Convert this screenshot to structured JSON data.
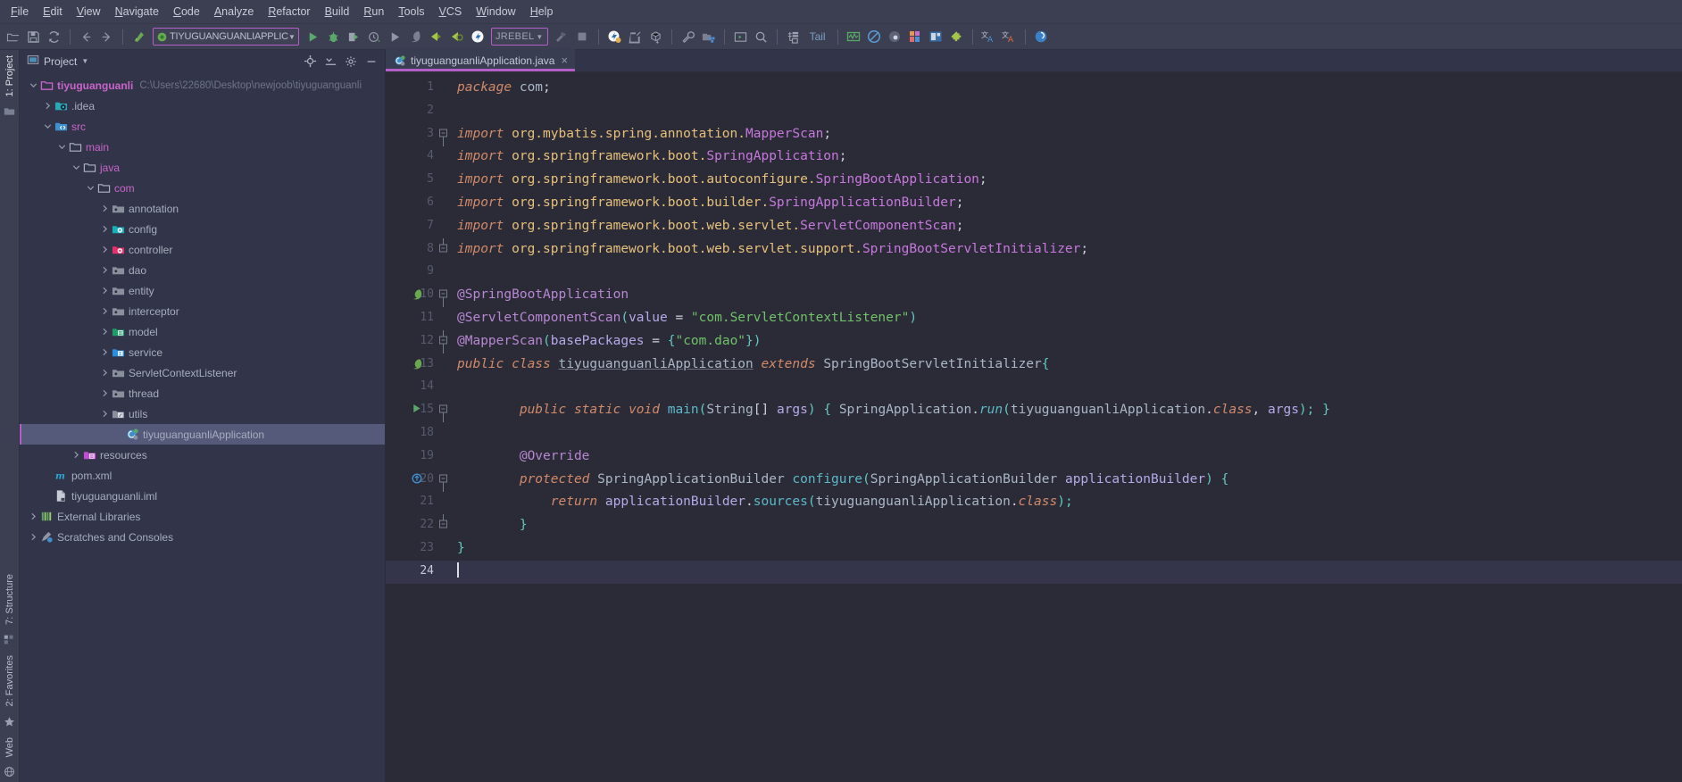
{
  "menu": {
    "items": [
      {
        "label": "File"
      },
      {
        "label": "Edit"
      },
      {
        "label": "View"
      },
      {
        "label": "Navigate"
      },
      {
        "label": "Code"
      },
      {
        "label": "Analyze"
      },
      {
        "label": "Refactor"
      },
      {
        "label": "Build"
      },
      {
        "label": "Run"
      },
      {
        "label": "Tools"
      },
      {
        "label": "VCS"
      },
      {
        "label": "Window"
      },
      {
        "label": "Help"
      }
    ]
  },
  "toolbar": {
    "run_config": "TIYUGUANGUANLIAPPLICATION",
    "run_config_arrow": "▼",
    "jrebel_label": "JREBEL",
    "jrebel_arrow": "▼",
    "tail_label": "Tail",
    "icons": [
      "open-folder-icon",
      "save-all-icon",
      "sync-refresh-icon",
      "back-arrow-icon",
      "forward-arrow-icon",
      "compile-icon",
      "run-icon",
      "debug-icon",
      "run-with-coverage-icon",
      "profile-icon",
      "rerun-icon",
      "stop-gray-icon",
      "jrebel-run-icon",
      "jrebel-debug-icon",
      "jrebel-logo-icon",
      "hammer-icon",
      "stop-square-icon",
      "jrebel-settings-icon",
      "update-app-icon",
      "build-artifact-icon",
      "wrench-settings-icon",
      "project-structure-icon",
      "terminal-icon",
      "search-everywhere-icon",
      "database-icon",
      "monitor-chart-icon",
      "no-entry-icon",
      "record-icon",
      "layout-colors-icon",
      "ui-designer-icon",
      "plugin-puzzle-icon",
      "translate-blue-icon",
      "translate-red-icon",
      "help-circle-icon"
    ]
  },
  "left_strip": {
    "tabs_top": [
      "1: Project"
    ],
    "tabs_bottom": [
      "7: Structure",
      "2: Favorites",
      "Web"
    ]
  },
  "project_panel": {
    "title": "Project",
    "title_arrow": "▼",
    "buttons": [
      "locate-target-icon",
      "collapse-all-icon",
      "settings-gear-icon",
      "hide-minus-icon"
    ],
    "tree": [
      {
        "depth": 0,
        "arrow": "down",
        "icon": "module-folder-icon",
        "label": "tiyuguanguanli",
        "style": "bold",
        "path": "C:\\Users\\22680\\Desktop\\newjoob\\tiyuguanguanli"
      },
      {
        "depth": 1,
        "arrow": "right",
        "icon": "idea-folder-icon",
        "label": ".idea",
        "style": "normal",
        "path": ""
      },
      {
        "depth": 1,
        "arrow": "down",
        "icon": "source-folder-icon",
        "label": "src",
        "style": "pink",
        "path": ""
      },
      {
        "depth": 2,
        "arrow": "down",
        "icon": "plain-folder-icon",
        "label": "main",
        "style": "pink",
        "path": ""
      },
      {
        "depth": 3,
        "arrow": "down",
        "icon": "plain-folder-icon",
        "label": "java",
        "style": "pink",
        "path": ""
      },
      {
        "depth": 4,
        "arrow": "down",
        "icon": "plain-folder-icon",
        "label": "com",
        "style": "pink",
        "path": ""
      },
      {
        "depth": 5,
        "arrow": "right",
        "icon": "package-folder-icon",
        "label": "annotation",
        "style": "normal",
        "path": ""
      },
      {
        "depth": 5,
        "arrow": "right",
        "icon": "config-folder-icon",
        "label": "config",
        "style": "normal",
        "path": ""
      },
      {
        "depth": 5,
        "arrow": "right",
        "icon": "controller-folder-icon",
        "label": "controller",
        "style": "normal",
        "path": ""
      },
      {
        "depth": 5,
        "arrow": "right",
        "icon": "package-folder-icon",
        "label": "dao",
        "style": "normal",
        "path": ""
      },
      {
        "depth": 5,
        "arrow": "right",
        "icon": "package-folder-icon",
        "label": "entity",
        "style": "normal",
        "path": ""
      },
      {
        "depth": 5,
        "arrow": "right",
        "icon": "package-folder-icon",
        "label": "interceptor",
        "style": "normal",
        "path": ""
      },
      {
        "depth": 5,
        "arrow": "right",
        "icon": "model-folder-icon",
        "label": "model",
        "style": "normal",
        "path": ""
      },
      {
        "depth": 5,
        "arrow": "right",
        "icon": "service-folder-icon",
        "label": "service",
        "style": "normal",
        "path": ""
      },
      {
        "depth": 5,
        "arrow": "right",
        "icon": "package-folder-icon",
        "label": "ServletContextListener",
        "style": "normal",
        "path": ""
      },
      {
        "depth": 5,
        "arrow": "right",
        "icon": "package-folder-icon",
        "label": "thread",
        "style": "normal",
        "path": ""
      },
      {
        "depth": 5,
        "arrow": "right",
        "icon": "utils-folder-icon",
        "label": "utils",
        "style": "normal",
        "path": ""
      },
      {
        "depth": 6,
        "arrow": "none",
        "icon": "spring-class-icon",
        "label": "tiyuguanguanliApplication",
        "style": "normal",
        "path": "",
        "selected": true
      },
      {
        "depth": 3,
        "arrow": "right",
        "icon": "resources-folder-icon",
        "label": "resources",
        "style": "normal",
        "path": ""
      },
      {
        "depth": 1,
        "arrow": "none",
        "icon": "maven-pom-icon",
        "label": "pom.xml",
        "style": "normal",
        "path": ""
      },
      {
        "depth": 1,
        "arrow": "none",
        "icon": "iml-file-icon",
        "label": "tiyuguanguanli.iml",
        "style": "normal",
        "path": ""
      },
      {
        "depth": 0,
        "arrow": "right",
        "icon": "external-libraries-icon",
        "label": "External Libraries",
        "style": "normal",
        "path": ""
      },
      {
        "depth": 0,
        "arrow": "right",
        "icon": "scratches-icon",
        "label": "Scratches and Consoles",
        "style": "normal",
        "path": ""
      }
    ]
  },
  "editor": {
    "tab": {
      "label": "tiyuguanguanliApplication.java",
      "icon": "spring-class-icon",
      "close": "×"
    },
    "current_line": 24,
    "lines": [
      {
        "n": 1,
        "tokens": [
          {
            "t": "package ",
            "c": "kw"
          },
          {
            "t": "com",
            "c": "ident"
          },
          {
            "t": ";",
            "c": "punc"
          }
        ]
      },
      {
        "n": 2,
        "tokens": []
      },
      {
        "n": 3,
        "fold": "start",
        "tokens": [
          {
            "t": "import ",
            "c": "kw"
          },
          {
            "t": "org.mybatis.spring.annotation.",
            "c": "pkg"
          },
          {
            "t": "MapperScan",
            "c": "field"
          },
          {
            "t": ";",
            "c": "punc"
          }
        ]
      },
      {
        "n": 4,
        "tokens": [
          {
            "t": "import ",
            "c": "kw"
          },
          {
            "t": "org.springframework.boot.",
            "c": "pkg"
          },
          {
            "t": "SpringApplication",
            "c": "field"
          },
          {
            "t": ";",
            "c": "punc"
          }
        ]
      },
      {
        "n": 5,
        "tokens": [
          {
            "t": "import ",
            "c": "kw"
          },
          {
            "t": "org.springframework.boot.autoconfigure.",
            "c": "pkg"
          },
          {
            "t": "SpringBootApplication",
            "c": "field"
          },
          {
            "t": ";",
            "c": "punc"
          }
        ]
      },
      {
        "n": 6,
        "tokens": [
          {
            "t": "import ",
            "c": "kw"
          },
          {
            "t": "org.springframework.boot.builder.",
            "c": "pkg"
          },
          {
            "t": "SpringApplicationBuilder",
            "c": "field"
          },
          {
            "t": ";",
            "c": "punc"
          }
        ]
      },
      {
        "n": 7,
        "tokens": [
          {
            "t": "import ",
            "c": "kw"
          },
          {
            "t": "org.springframework.boot.web.servlet.",
            "c": "pkg"
          },
          {
            "t": "ServletComponentScan",
            "c": "field"
          },
          {
            "t": ";",
            "c": "punc"
          }
        ]
      },
      {
        "n": 8,
        "fold": "end",
        "tokens": [
          {
            "t": "import ",
            "c": "kw"
          },
          {
            "t": "org.springframework.boot.web.servlet.support.",
            "c": "pkg"
          },
          {
            "t": "SpringBootServletInitializer",
            "c": "field"
          },
          {
            "t": ";",
            "c": "punc"
          }
        ]
      },
      {
        "n": 9,
        "tokens": []
      },
      {
        "n": 10,
        "gutter": "spring-bean-icon",
        "fold": "start",
        "tokens": [
          {
            "t": "@SpringBootApplication",
            "c": "ann"
          }
        ]
      },
      {
        "n": 11,
        "tokens": [
          {
            "t": "@ServletComponentScan",
            "c": "ann"
          },
          {
            "t": "(",
            "c": "brace1"
          },
          {
            "t": "value",
            "c": "param"
          },
          {
            "t": " = ",
            "c": "punc"
          },
          {
            "t": "\"com.ServletContextListener\"",
            "c": "str"
          },
          {
            "t": ")",
            "c": "brace1"
          }
        ]
      },
      {
        "n": 12,
        "fold": "mid",
        "tokens": [
          {
            "t": "@MapperScan",
            "c": "ann"
          },
          {
            "t": "(",
            "c": "brace1"
          },
          {
            "t": "basePackages",
            "c": "param"
          },
          {
            "t": " = ",
            "c": "punc"
          },
          {
            "t": "{",
            "c": "brace1"
          },
          {
            "t": "\"com.dao\"",
            "c": "str"
          },
          {
            "t": "}",
            "c": "brace1"
          },
          {
            "t": ")",
            "c": "brace1"
          }
        ]
      },
      {
        "n": 13,
        "gutter": "spring-run-icon",
        "tokens": [
          {
            "t": "public ",
            "c": "kw"
          },
          {
            "t": "class ",
            "c": "kw"
          },
          {
            "t": "tiyuguanguanliApplication",
            "c": "cls underline"
          },
          {
            "t": " extends ",
            "c": "kw"
          },
          {
            "t": "SpringBootServletInitializer",
            "c": "type"
          },
          {
            "t": "{",
            "c": "brace1"
          }
        ]
      },
      {
        "n": 14,
        "tokens": []
      },
      {
        "n": 15,
        "gutter": "run-method-icon",
        "fold": "start",
        "indent": 2,
        "tokens": [
          {
            "t": "public ",
            "c": "kw"
          },
          {
            "t": "static ",
            "c": "kw"
          },
          {
            "t": "void ",
            "c": "kw"
          },
          {
            "t": "main",
            "c": "meth"
          },
          {
            "t": "(",
            "c": "brace1"
          },
          {
            "t": "String",
            "c": "type"
          },
          {
            "t": "[] ",
            "c": "punc"
          },
          {
            "t": "args",
            "c": "param"
          },
          {
            "t": ") { ",
            "c": "brace1"
          },
          {
            "t": "SpringApplication",
            "c": "type"
          },
          {
            "t": ".",
            "c": "punc"
          },
          {
            "t": "run",
            "c": "meth static-it"
          },
          {
            "t": "(",
            "c": "brace1"
          },
          {
            "t": "tiyuguanguanliApplication",
            "c": "type"
          },
          {
            "t": ".",
            "c": "punc"
          },
          {
            "t": "class",
            "c": "kw"
          },
          {
            "t": ", ",
            "c": "punc"
          },
          {
            "t": "args",
            "c": "param"
          },
          {
            "t": "); }",
            "c": "brace1"
          }
        ]
      },
      {
        "n": 18,
        "tokens": []
      },
      {
        "n": 19,
        "indent": 2,
        "tokens": [
          {
            "t": "@Override",
            "c": "ann"
          }
        ]
      },
      {
        "n": 20,
        "gutter": "override-icon",
        "fold": "start",
        "indent": 2,
        "tokens": [
          {
            "t": "protected ",
            "c": "kw"
          },
          {
            "t": "SpringApplicationBuilder ",
            "c": "type"
          },
          {
            "t": "configure",
            "c": "meth"
          },
          {
            "t": "(",
            "c": "brace1"
          },
          {
            "t": "SpringApplicationBuilder",
            "c": "type"
          },
          {
            "t": " ",
            "c": "punc"
          },
          {
            "t": "applicationBuilder",
            "c": "param"
          },
          {
            "t": ") {",
            "c": "brace1"
          }
        ]
      },
      {
        "n": 21,
        "indent": 3,
        "tokens": [
          {
            "t": "return ",
            "c": "kw"
          },
          {
            "t": "applicationBuilder",
            "c": "param"
          },
          {
            "t": ".",
            "c": "punc"
          },
          {
            "t": "sources",
            "c": "meth"
          },
          {
            "t": "(",
            "c": "brace1"
          },
          {
            "t": "tiyuguanguanliApplication",
            "c": "type"
          },
          {
            "t": ".",
            "c": "punc"
          },
          {
            "t": "class",
            "c": "kw"
          },
          {
            "t": ");",
            "c": "brace1"
          }
        ]
      },
      {
        "n": 22,
        "fold": "end",
        "indent": 2,
        "tokens": [
          {
            "t": "}",
            "c": "brace1"
          }
        ]
      },
      {
        "n": 23,
        "tokens": [
          {
            "t": "}",
            "c": "brace1"
          }
        ]
      },
      {
        "n": 24,
        "current": true,
        "tokens": []
      }
    ]
  },
  "colors": {
    "accent": "#b45ec7",
    "panel_bg": "#32354a",
    "editor_bg": "#2b2b37",
    "toolbar_bg": "#3c3f51",
    "selection": "#55597a",
    "keyword": "#d08a6a",
    "string": "#71c168",
    "annotation": "#b887d3",
    "package": "#e6c07b",
    "method": "#5bb9c9"
  }
}
